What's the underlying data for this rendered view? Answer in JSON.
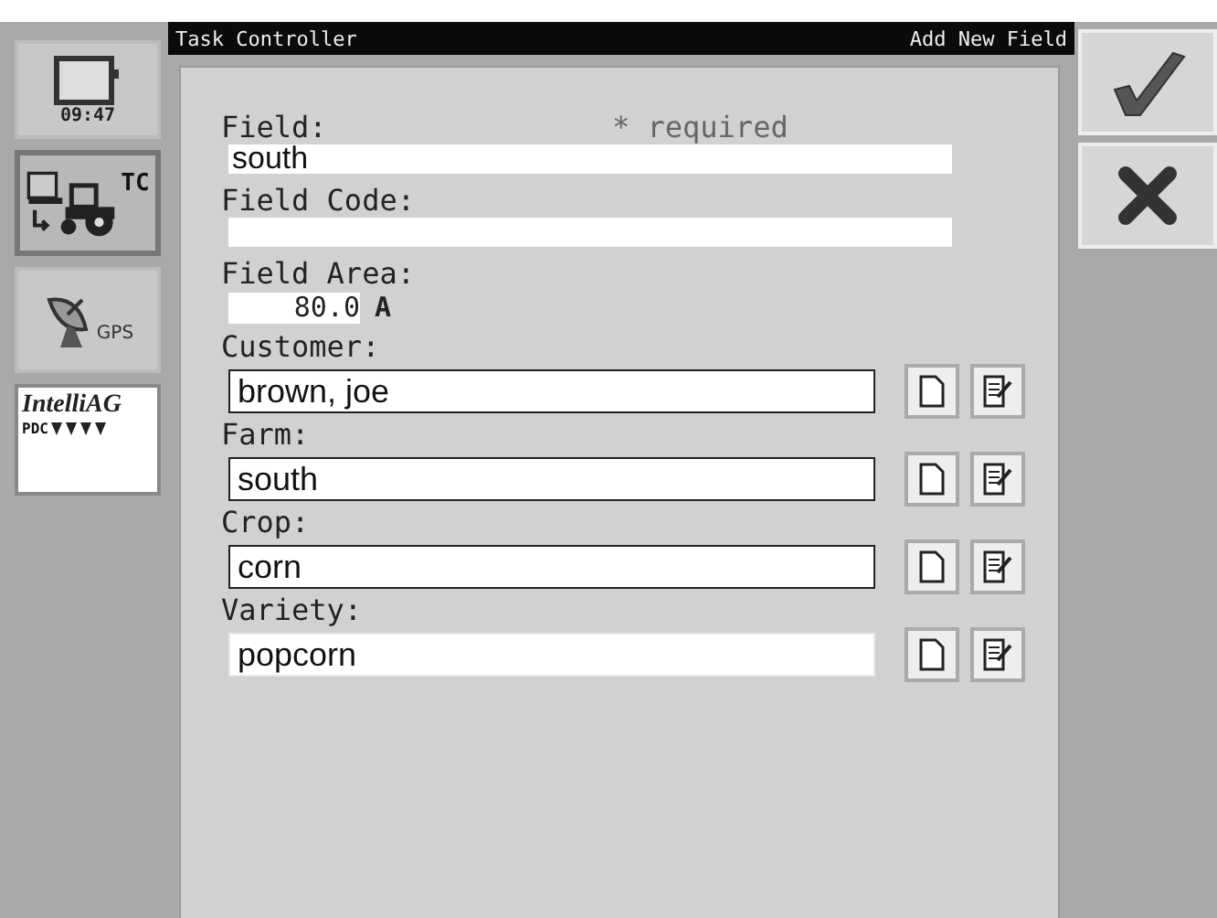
{
  "sidebar": {
    "items": [
      {
        "kind": "clock",
        "time": "09:47",
        "selected": false
      },
      {
        "kind": "tc",
        "label": "TC",
        "selected": true
      },
      {
        "kind": "gps",
        "label": "GPS",
        "selected": false
      },
      {
        "kind": "brand",
        "label": "IntelliAG",
        "sublabel": "PDC",
        "selected": false
      }
    ]
  },
  "header": {
    "title": "Task Controller",
    "screen": "Add New Field"
  },
  "required_note": "* required",
  "fields": [
    {
      "kind": "line",
      "label": "Field:",
      "value": "south"
    },
    {
      "kind": "line",
      "label": "Field Code:"
    },
    {
      "kind": "area",
      "label": "Field Area:",
      "value": "80.0",
      "unit": "A"
    },
    {
      "kind": "select",
      "label": "Customer:",
      "value": "brown, joe"
    },
    {
      "kind": "select",
      "label": "Farm:",
      "value": "south"
    },
    {
      "kind": "select",
      "label": "Crop:",
      "value": "corn"
    },
    {
      "kind": "entry",
      "label": "Variety:",
      "value": "popcorn"
    }
  ],
  "actions": [
    {
      "kind": "accept"
    },
    {
      "kind": "cancel"
    }
  ]
}
